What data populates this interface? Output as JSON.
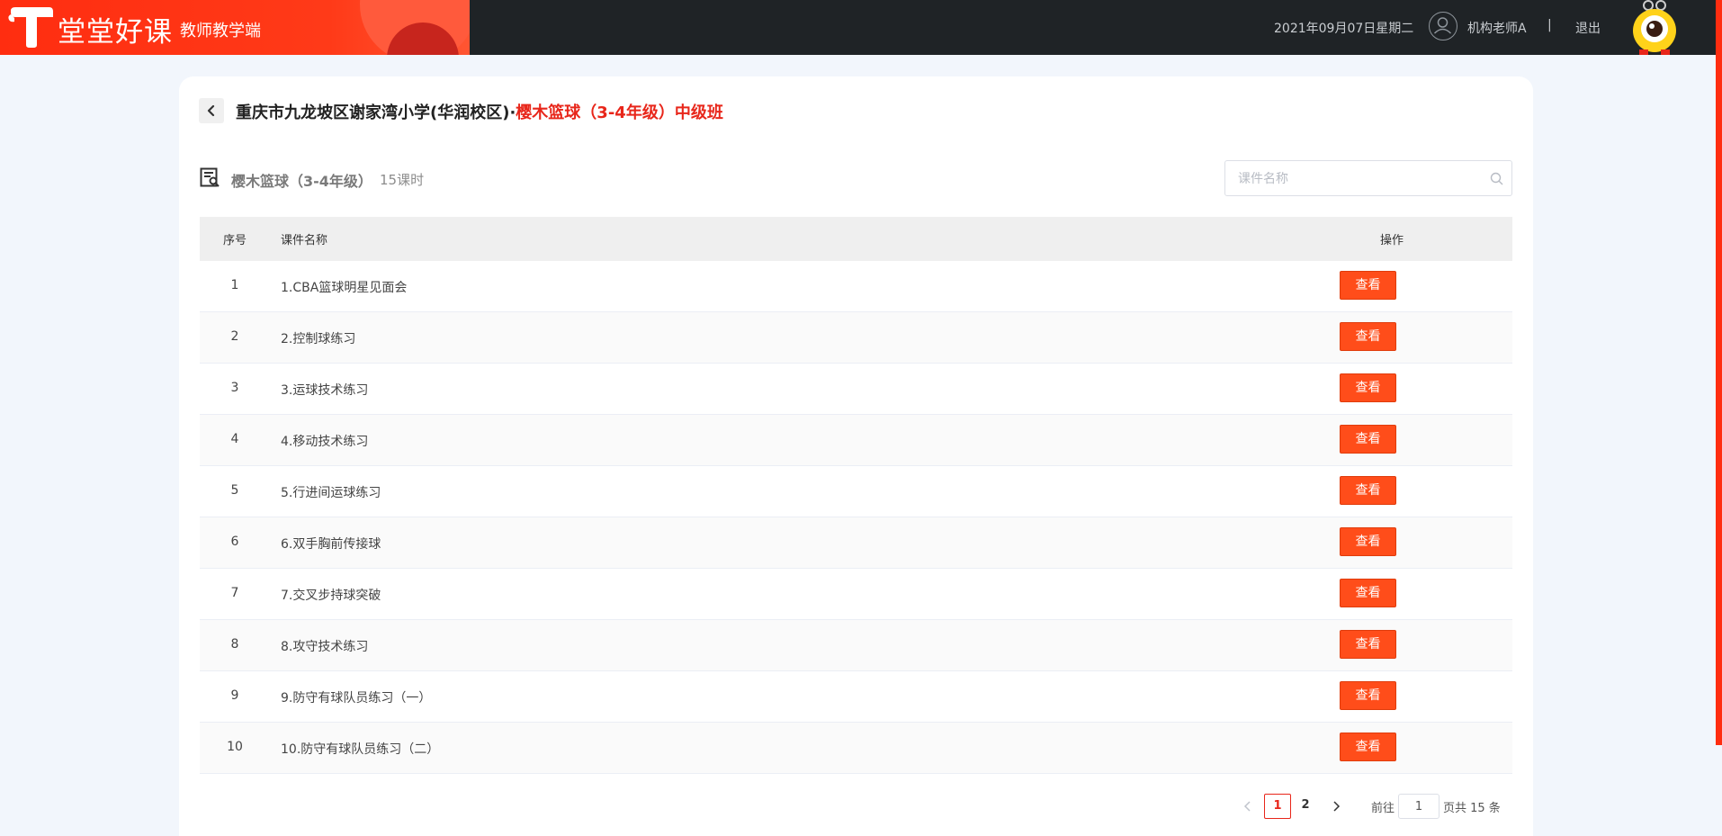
{
  "header": {
    "brand_name": "堂堂好课",
    "brand_sub": "教师教学端",
    "date": "2021年09月07日星期二",
    "user": "机构老师A",
    "separator": "|",
    "logout": "退出"
  },
  "page": {
    "school": "重庆市九龙坡区谢家湾小学(华润校区)·",
    "course_title": "樱木篮球（3-4年级）中级班"
  },
  "course": {
    "name": "樱木篮球（3-4年级）",
    "lessons": "15课时"
  },
  "search": {
    "placeholder": "课件名称"
  },
  "table": {
    "headers": {
      "index": "序号",
      "name": "课件名称",
      "op": "操作"
    },
    "view_label": "查看",
    "rows": [
      {
        "index": "1",
        "name": "1.CBA篮球明星见面会"
      },
      {
        "index": "2",
        "name": "2.控制球练习"
      },
      {
        "index": "3",
        "name": "3.运球技术练习"
      },
      {
        "index": "4",
        "name": "4.移动技术练习"
      },
      {
        "index": "5",
        "name": "5.行进间运球练习"
      },
      {
        "index": "6",
        "name": "6.双手胸前传接球"
      },
      {
        "index": "7",
        "name": "7.交叉步持球突破"
      },
      {
        "index": "8",
        "name": "8.攻守技术练习"
      },
      {
        "index": "9",
        "name": "9.防守有球队员练习（一）"
      },
      {
        "index": "10",
        "name": "10.防守有球队员练习（二）"
      }
    ]
  },
  "pagination": {
    "pages": [
      "1",
      "2"
    ],
    "current": "1",
    "goto_label": "前往",
    "goto_value": "1",
    "total_label": "页共 15 条"
  },
  "colors": {
    "accent": "#e8261a",
    "button": "#ff4d1a",
    "header_bg": "#1f2326"
  },
  "icons": {
    "back": "chevron-left-icon",
    "course": "course-document-icon",
    "search": "search-icon",
    "prev": "chevron-left-icon",
    "next": "chevron-right-icon",
    "user": "user-avatar-icon",
    "mascot": "mascot-icon"
  }
}
